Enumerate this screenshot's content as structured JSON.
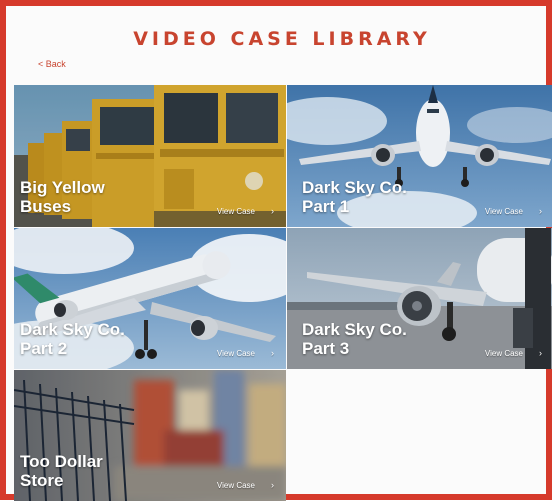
{
  "header": {
    "title": "VIDEO CASE LIBRARY",
    "back_label": "< Back"
  },
  "colors": {
    "accent": "#d63a2b",
    "title": "#c8442f"
  },
  "cases": [
    {
      "title": "Big Yellow\nBuses",
      "cta": "View Case",
      "icon": "chevron-right-icon"
    },
    {
      "title": "Dark Sky Co.\nPart 1",
      "cta": "View Case",
      "icon": "chevron-right-icon"
    },
    {
      "title": "Dark Sky Co.\nPart 2",
      "cta": "View Case",
      "icon": "chevron-right-icon"
    },
    {
      "title": "Dark Sky Co.\nPart 3",
      "cta": "View Case",
      "icon": "chevron-right-icon"
    },
    {
      "title": "Too Dollar\nStore",
      "cta": "View Case",
      "icon": "chevron-right-icon"
    }
  ]
}
